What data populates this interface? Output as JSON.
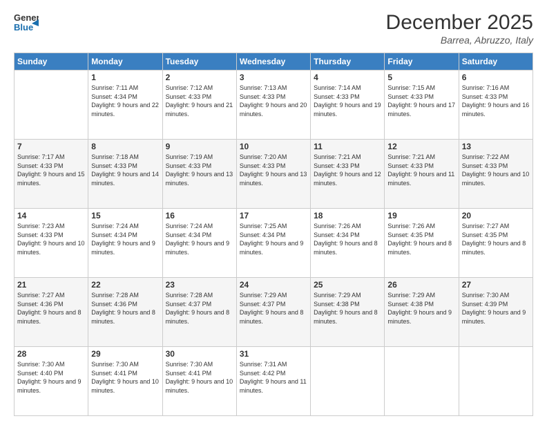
{
  "header": {
    "logo_general": "General",
    "logo_blue": "Blue",
    "month_title": "December 2025",
    "location": "Barrea, Abruzzo, Italy"
  },
  "weekdays": [
    "Sunday",
    "Monday",
    "Tuesday",
    "Wednesday",
    "Thursday",
    "Friday",
    "Saturday"
  ],
  "weeks": [
    [
      {
        "day": "",
        "sunrise": "",
        "sunset": "",
        "daylight": ""
      },
      {
        "day": "1",
        "sunrise": "Sunrise: 7:11 AM",
        "sunset": "Sunset: 4:34 PM",
        "daylight": "Daylight: 9 hours and 22 minutes."
      },
      {
        "day": "2",
        "sunrise": "Sunrise: 7:12 AM",
        "sunset": "Sunset: 4:33 PM",
        "daylight": "Daylight: 9 hours and 21 minutes."
      },
      {
        "day": "3",
        "sunrise": "Sunrise: 7:13 AM",
        "sunset": "Sunset: 4:33 PM",
        "daylight": "Daylight: 9 hours and 20 minutes."
      },
      {
        "day": "4",
        "sunrise": "Sunrise: 7:14 AM",
        "sunset": "Sunset: 4:33 PM",
        "daylight": "Daylight: 9 hours and 19 minutes."
      },
      {
        "day": "5",
        "sunrise": "Sunrise: 7:15 AM",
        "sunset": "Sunset: 4:33 PM",
        "daylight": "Daylight: 9 hours and 17 minutes."
      },
      {
        "day": "6",
        "sunrise": "Sunrise: 7:16 AM",
        "sunset": "Sunset: 4:33 PM",
        "daylight": "Daylight: 9 hours and 16 minutes."
      }
    ],
    [
      {
        "day": "7",
        "sunrise": "Sunrise: 7:17 AM",
        "sunset": "Sunset: 4:33 PM",
        "daylight": "Daylight: 9 hours and 15 minutes."
      },
      {
        "day": "8",
        "sunrise": "Sunrise: 7:18 AM",
        "sunset": "Sunset: 4:33 PM",
        "daylight": "Daylight: 9 hours and 14 minutes."
      },
      {
        "day": "9",
        "sunrise": "Sunrise: 7:19 AM",
        "sunset": "Sunset: 4:33 PM",
        "daylight": "Daylight: 9 hours and 13 minutes."
      },
      {
        "day": "10",
        "sunrise": "Sunrise: 7:20 AM",
        "sunset": "Sunset: 4:33 PM",
        "daylight": "Daylight: 9 hours and 13 minutes."
      },
      {
        "day": "11",
        "sunrise": "Sunrise: 7:21 AM",
        "sunset": "Sunset: 4:33 PM",
        "daylight": "Daylight: 9 hours and 12 minutes."
      },
      {
        "day": "12",
        "sunrise": "Sunrise: 7:21 AM",
        "sunset": "Sunset: 4:33 PM",
        "daylight": "Daylight: 9 hours and 11 minutes."
      },
      {
        "day": "13",
        "sunrise": "Sunrise: 7:22 AM",
        "sunset": "Sunset: 4:33 PM",
        "daylight": "Daylight: 9 hours and 10 minutes."
      }
    ],
    [
      {
        "day": "14",
        "sunrise": "Sunrise: 7:23 AM",
        "sunset": "Sunset: 4:33 PM",
        "daylight": "Daylight: 9 hours and 10 minutes."
      },
      {
        "day": "15",
        "sunrise": "Sunrise: 7:24 AM",
        "sunset": "Sunset: 4:34 PM",
        "daylight": "Daylight: 9 hours and 9 minutes."
      },
      {
        "day": "16",
        "sunrise": "Sunrise: 7:24 AM",
        "sunset": "Sunset: 4:34 PM",
        "daylight": "Daylight: 9 hours and 9 minutes."
      },
      {
        "day": "17",
        "sunrise": "Sunrise: 7:25 AM",
        "sunset": "Sunset: 4:34 PM",
        "daylight": "Daylight: 9 hours and 9 minutes."
      },
      {
        "day": "18",
        "sunrise": "Sunrise: 7:26 AM",
        "sunset": "Sunset: 4:34 PM",
        "daylight": "Daylight: 9 hours and 8 minutes."
      },
      {
        "day": "19",
        "sunrise": "Sunrise: 7:26 AM",
        "sunset": "Sunset: 4:35 PM",
        "daylight": "Daylight: 9 hours and 8 minutes."
      },
      {
        "day": "20",
        "sunrise": "Sunrise: 7:27 AM",
        "sunset": "Sunset: 4:35 PM",
        "daylight": "Daylight: 9 hours and 8 minutes."
      }
    ],
    [
      {
        "day": "21",
        "sunrise": "Sunrise: 7:27 AM",
        "sunset": "Sunset: 4:36 PM",
        "daylight": "Daylight: 9 hours and 8 minutes."
      },
      {
        "day": "22",
        "sunrise": "Sunrise: 7:28 AM",
        "sunset": "Sunset: 4:36 PM",
        "daylight": "Daylight: 9 hours and 8 minutes."
      },
      {
        "day": "23",
        "sunrise": "Sunrise: 7:28 AM",
        "sunset": "Sunset: 4:37 PM",
        "daylight": "Daylight: 9 hours and 8 minutes."
      },
      {
        "day": "24",
        "sunrise": "Sunrise: 7:29 AM",
        "sunset": "Sunset: 4:37 PM",
        "daylight": "Daylight: 9 hours and 8 minutes."
      },
      {
        "day": "25",
        "sunrise": "Sunrise: 7:29 AM",
        "sunset": "Sunset: 4:38 PM",
        "daylight": "Daylight: 9 hours and 8 minutes."
      },
      {
        "day": "26",
        "sunrise": "Sunrise: 7:29 AM",
        "sunset": "Sunset: 4:38 PM",
        "daylight": "Daylight: 9 hours and 9 minutes."
      },
      {
        "day": "27",
        "sunrise": "Sunrise: 7:30 AM",
        "sunset": "Sunset: 4:39 PM",
        "daylight": "Daylight: 9 hours and 9 minutes."
      }
    ],
    [
      {
        "day": "28",
        "sunrise": "Sunrise: 7:30 AM",
        "sunset": "Sunset: 4:40 PM",
        "daylight": "Daylight: 9 hours and 9 minutes."
      },
      {
        "day": "29",
        "sunrise": "Sunrise: 7:30 AM",
        "sunset": "Sunset: 4:41 PM",
        "daylight": "Daylight: 9 hours and 10 minutes."
      },
      {
        "day": "30",
        "sunrise": "Sunrise: 7:30 AM",
        "sunset": "Sunset: 4:41 PM",
        "daylight": "Daylight: 9 hours and 10 minutes."
      },
      {
        "day": "31",
        "sunrise": "Sunrise: 7:31 AM",
        "sunset": "Sunset: 4:42 PM",
        "daylight": "Daylight: 9 hours and 11 minutes."
      },
      {
        "day": "",
        "sunrise": "",
        "sunset": "",
        "daylight": ""
      },
      {
        "day": "",
        "sunrise": "",
        "sunset": "",
        "daylight": ""
      },
      {
        "day": "",
        "sunrise": "",
        "sunset": "",
        "daylight": ""
      }
    ]
  ]
}
